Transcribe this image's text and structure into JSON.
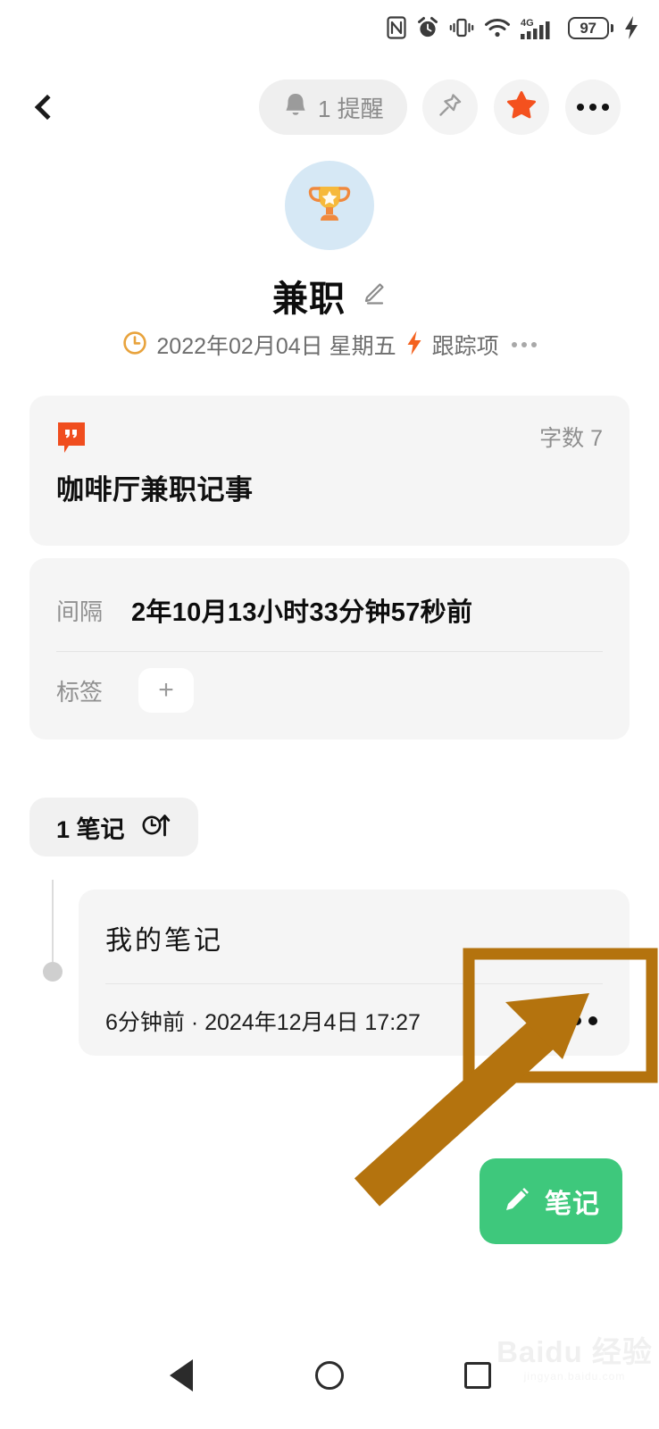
{
  "status_bar": {
    "icons": [
      "nfc-icon",
      "alarm-icon",
      "vibrate-icon",
      "wifi-icon",
      "signal-4g-icon"
    ],
    "network_label": "4G",
    "battery_level": "97",
    "charging": true
  },
  "top_nav": {
    "back_icon": "back-chevron-icon",
    "reminder": {
      "icon": "bell-icon",
      "label": "1 提醒"
    },
    "pin_icon": "pin-icon",
    "star_icon": "star-icon",
    "more_icon": "more-horizontal-icon",
    "star_color": "#F4511E"
  },
  "header": {
    "avatar_icon": "trophy-icon",
    "avatar_bg": "#D6E8F5",
    "title": "兼职",
    "edit_icon": "pencil-icon",
    "clock_icon": "clock-icon",
    "date": "2022年02月04日 星期五",
    "lightning_icon": "lightning-icon",
    "tracker_label": "跟踪项",
    "overflow_icon": "more-horizontal-icon"
  },
  "quote_card": {
    "icon": "quote-bubble-icon",
    "icon_color": "#F04D1E",
    "wordcount_label": "字数 7",
    "body": "咖啡厅兼职记事"
  },
  "meta_card": {
    "interval_key": "间隔",
    "interval_value": "2年10月13小时33分钟57秒前",
    "tags_key": "标签",
    "tags_add_label": "+"
  },
  "notes_section": {
    "count_label": "1 笔记",
    "sort_icon": "clock-sort-ascending-icon",
    "note": {
      "title": "我的笔记",
      "timestamp": "6分钟前 · 2024年12月4日 17:27",
      "more_icon": "more-horizontal-icon"
    }
  },
  "annotation": {
    "color": "#B4730E",
    "shape": "rectangle-with-arrow",
    "target": "note-more-menu"
  },
  "fab": {
    "icon": "pencil-icon",
    "label": "笔记",
    "color": "#3EC87C"
  },
  "watermark": {
    "text": "Baidu 经验",
    "subtext": "jingyan.baidu.com"
  },
  "bottom_nav": {
    "back": "nav-back-icon",
    "home": "nav-home-icon",
    "recents": "nav-recents-icon"
  }
}
